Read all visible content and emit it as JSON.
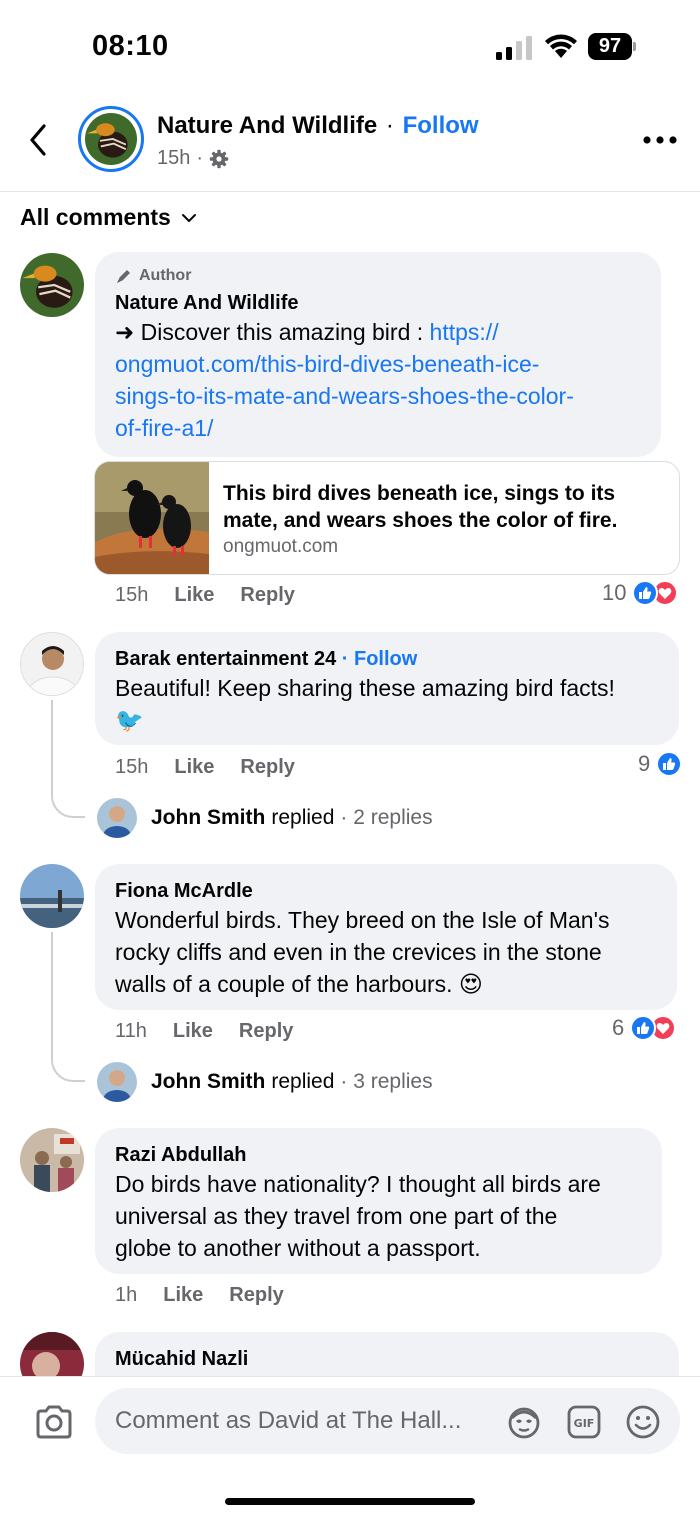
{
  "status_bar": {
    "time": "08:10",
    "battery": "97"
  },
  "header": {
    "page_name": "Nature And Wildlife",
    "separator": "·",
    "follow": "Follow",
    "time": "15h",
    "meta_separator": "·",
    "icons": {
      "back": "chevron-left-icon",
      "settings": "gear-icon",
      "more": "more-dots-icon"
    }
  },
  "filter": {
    "label": "All comments"
  },
  "comments": [
    {
      "badge": "Author",
      "author": "Nature And Wildlife",
      "text_prefix": "➜ Discover this amazing bird : ",
      "link": "https://ongmuot.com/this-bird-dives-beneath-ice-sings-to-its-mate-and-wears-shoes-the-color-of-fire-a1/",
      "link_line1": "https://",
      "link_line2": "ongmuot.com/this-bird-dives-beneath-ice-",
      "link_line3": "sings-to-its-mate-and-wears-shoes-the-color-",
      "link_line4": "of-fire-a1/",
      "card": {
        "title": "This bird dives beneath ice, sings to its mate, and wears shoes the color of fire.",
        "domain": "ongmuot.com"
      },
      "time": "15h",
      "like": "Like",
      "reply": "Reply",
      "reaction_count": "10"
    },
    {
      "author": "Barak entertainment 24",
      "separator": "·",
      "follow": "Follow",
      "text": "Beautiful! Keep sharing these amazing bird facts!",
      "emoji": "🐦",
      "time": "15h",
      "like": "Like",
      "reply": "Reply",
      "reaction_count": "9",
      "replies": {
        "name": "John Smith",
        "verb": "replied",
        "count": "· 2 replies"
      }
    },
    {
      "author": "Fiona McArdle",
      "text_line1": "Wonderful birds. They breed on the Isle of Man's",
      "text_line2": "rocky cliffs and even in the crevices in the stone",
      "text_line3": "walls of a couple of the harbours. 😍",
      "time": "11h",
      "like": "Like",
      "reply": "Reply",
      "reaction_count": "6",
      "replies": {
        "name": "John Smith",
        "verb": "replied",
        "count": "· 3 replies"
      }
    },
    {
      "author": "Razi Abdullah",
      "text_line1": "Do birds have nationality? I thought all birds are",
      "text_line2": "universal as they travel from one part of the",
      "text_line3": "globe to another without a passport.",
      "time": "1h",
      "like": "Like",
      "reply": "Reply"
    },
    {
      "author": "Mücahid Nazli"
    }
  ],
  "composer": {
    "placeholder": "Comment as David at The Hall...",
    "icons": [
      "camera-icon",
      "avatar-sticker-icon",
      "gif-icon",
      "emoji-icon"
    ]
  },
  "colors": {
    "accent": "#1877f2",
    "bubble": "#f0f2f5",
    "secondary_text": "#65676b",
    "love": "#f33e58"
  }
}
